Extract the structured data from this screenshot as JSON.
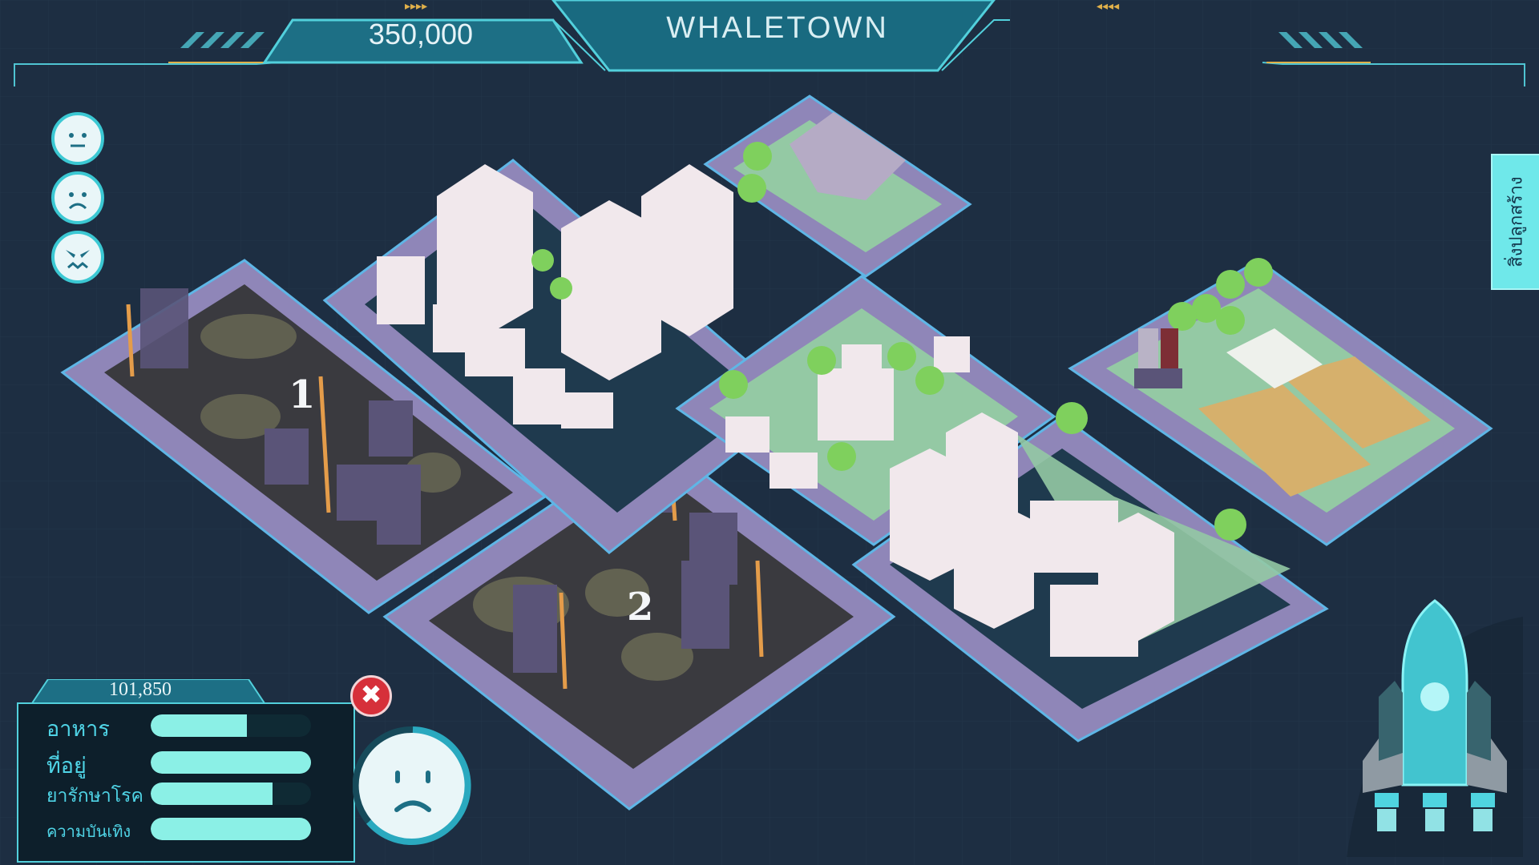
{
  "hud": {
    "money": "350,000",
    "city_name": "WHALETOWN",
    "arrows_left": "▸▸▸▸",
    "arrows_right": "◂◂◂◂"
  },
  "mood_buttons": [
    {
      "icon": "neutral-face-icon"
    },
    {
      "icon": "sad-face-icon"
    },
    {
      "icon": "angry-face-icon"
    }
  ],
  "side_tab": {
    "label": "สิ่งปลูกสร้าง"
  },
  "lots": [
    {
      "label": "1"
    },
    {
      "label": "2"
    }
  ],
  "stats_panel": {
    "population": "101,850",
    "items": [
      {
        "label": "อาหาร",
        "level": 0.6
      },
      {
        "label": "ที่อยู่",
        "level": 1.0
      },
      {
        "label": "ยารักษาโรค",
        "level": 0.76
      },
      {
        "label": "ความบันเทิง",
        "level": 1.0
      }
    ]
  },
  "close_button": {
    "glyph": "✖",
    "icon": "close-icon"
  },
  "status_face": {
    "icon": "sad-face-icon"
  },
  "rocket": {
    "icon": "rocket-icon"
  },
  "colors": {
    "background": "#1d2e42",
    "accent": "#3bc8d3",
    "road": "#8f86b8",
    "grass": "#94c9a4",
    "dirt": "#3a3a3f",
    "building": "#f1e8ec"
  }
}
